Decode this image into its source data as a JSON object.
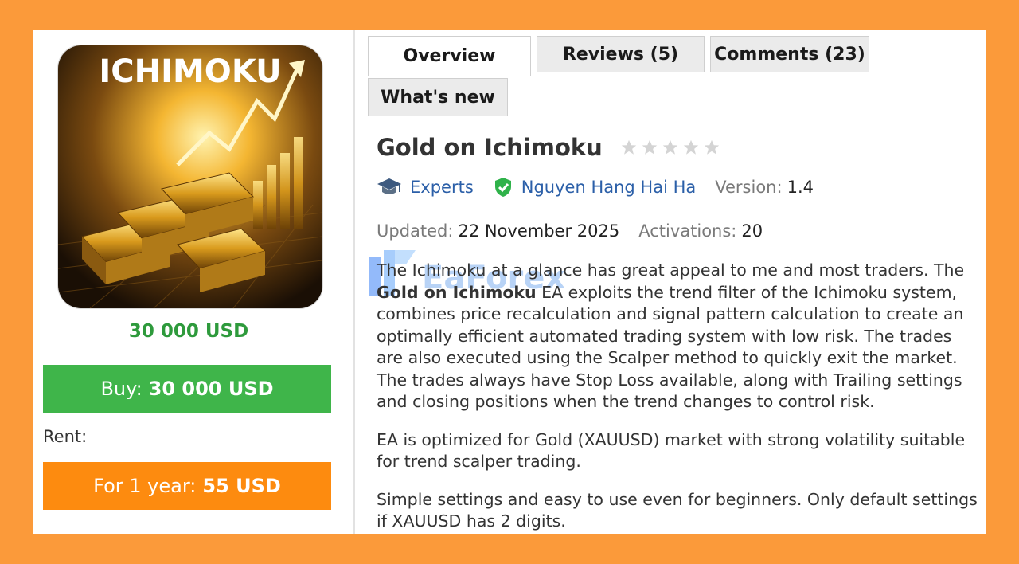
{
  "product": {
    "image_caption": "ICHIMOKU",
    "price": "30 000 USD",
    "buy_label": "Buy:",
    "buy_price": "30 000 USD",
    "rent_label": "Rent:",
    "rent_option_label": "For 1 year:",
    "rent_option_price": "55 USD"
  },
  "tabs": [
    {
      "label": "Overview",
      "active": true
    },
    {
      "label": "Reviews (5)",
      "active": false
    },
    {
      "label": "Comments (23)",
      "active": false
    },
    {
      "label": "What's new",
      "active": false
    }
  ],
  "details": {
    "title": "Gold on Ichimoku",
    "rating_stars": 0,
    "category": "Experts",
    "author": "Nguyen Hang Hai Ha",
    "version_label": "Version:",
    "version": "1.4",
    "updated_label": "Updated:",
    "updated": "22 November 2025",
    "activations_label": "Activations:",
    "activations": "20"
  },
  "description": {
    "p1_start": "The Ichimoku at a glance has great appeal to me and most traders. The ",
    "p1_bold": "Gold on Ichimoku",
    "p1_end": " EA exploits the trend filter of the Ichimoku system, combines price recalculation and signal pattern calculation to create an optimally efficient automated trading system with low risk. The trades are also executed using the Scalper method to quickly exit the market. The trades always have Stop Loss available, along with Trailing settings and closing positions when the trend changes to control risk.",
    "p2": "EA is optimized for Gold (XAUUSD) market with strong volatility suitable for trend scalper trading.",
    "p3": "Simple settings and easy to use even for beginners. Only default settings if XAUUSD has 2 digits."
  },
  "watermark_text": "EaForex",
  "colors": {
    "background": "#fb9a3a",
    "price_green": "#2e9a3c",
    "buy_button": "#3fb54a",
    "rent_button": "#fd8b0f",
    "link_blue": "#2b5fa8",
    "verified_green": "#2fb24a"
  }
}
